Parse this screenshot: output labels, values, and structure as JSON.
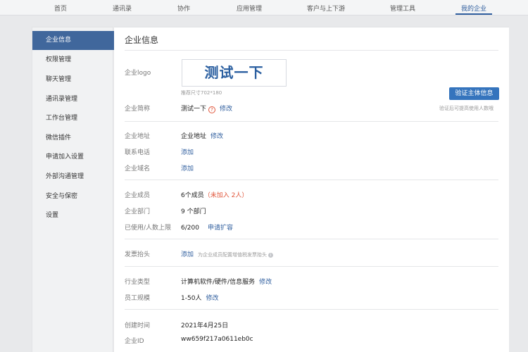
{
  "topnav": {
    "tabs": [
      "首页",
      "通讯录",
      "协作",
      "应用管理",
      "客户与上下游",
      "管理工具",
      "我的企业"
    ],
    "active_tab": "我的企业"
  },
  "sidebar": {
    "items": [
      "企业信息",
      "权限管理",
      "聊天管理",
      "通讯录管理",
      "工作台管理",
      "微信插件",
      "申请加入设置",
      "外部沟通管理",
      "安全与保密",
      "设置"
    ],
    "active_item": "企业信息"
  },
  "main": {
    "title": "企业信息",
    "logo": {
      "label": "企业logo",
      "text": "测试一下",
      "size_hint": "推荐尺寸702*180"
    },
    "verify": {
      "button": "验证主体信息",
      "hint": "验证后可提高使用人数哦"
    },
    "short_name": {
      "label": "企业简称",
      "value": "测试一下",
      "help_icon": "?",
      "action": "修改"
    },
    "address": {
      "label": "企业地址",
      "value": "企业地址",
      "action": "修改"
    },
    "phone": {
      "label": "联系电话",
      "action": "添加"
    },
    "domain": {
      "label": "企业域名",
      "action": "添加"
    },
    "members": {
      "label": "企业成员",
      "value": "6个成员",
      "note": "（未加入 2人）"
    },
    "departments": {
      "label": "企业部门",
      "value": "9 个部门"
    },
    "usage": {
      "label": "已使用/人数上限",
      "value": "6/200",
      "action": "申请扩容"
    },
    "invoice": {
      "label": "发票抬头",
      "action": "添加",
      "hint": "为企业成员配置增值税发票抬头"
    },
    "industry": {
      "label": "行业类型",
      "value": "计算机软件/硬件/信息服务",
      "action": "修改"
    },
    "scale": {
      "label": "员工规模",
      "value": "1-50人",
      "action": "修改"
    },
    "created": {
      "label": "创建时间",
      "value": "2021年4月25日"
    },
    "corp_id": {
      "label": "企业ID",
      "value": "ww659f217a0611eb0c"
    }
  },
  "colors": {
    "accent": "#2f5e9e",
    "sidebar_active": "#40679c",
    "button": "#3574bd",
    "warning": "#e0553a"
  }
}
